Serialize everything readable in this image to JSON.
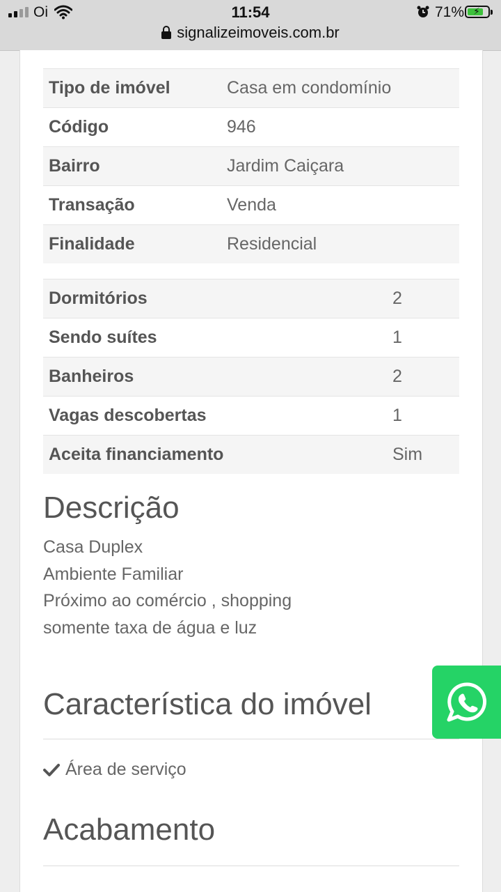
{
  "status_bar": {
    "carrier": "Oi",
    "time": "11:54",
    "battery": "71%"
  },
  "browser": {
    "url": "signalizeimoveis.com.br"
  },
  "details": [
    {
      "label": "Tipo de imóvel",
      "value": "Casa em condomínio"
    },
    {
      "label": "Código",
      "value": "946"
    },
    {
      "label": "Bairro",
      "value": "Jardim Caiçara"
    },
    {
      "label": "Transação",
      "value": "Venda"
    },
    {
      "label": "Finalidade",
      "value": "Residencial"
    }
  ],
  "rooms": [
    {
      "label": "Dormitórios",
      "value": "2"
    },
    {
      "label": "Sendo suítes",
      "value": "1"
    },
    {
      "label": "Banheiros",
      "value": "2"
    },
    {
      "label": "Vagas descobertas",
      "value": "1"
    },
    {
      "label": "Aceita financiamento",
      "value": "Sim"
    }
  ],
  "description": {
    "title": "Descrição",
    "lines": [
      "Casa Duplex",
      "Ambiente Familiar",
      "Próximo ao comércio , shopping",
      "somente taxa de água e luz"
    ]
  },
  "features": {
    "title": "Característica do imóvel",
    "items": [
      "Área de serviço"
    ]
  },
  "finishing": {
    "title": "Acabamento"
  },
  "icons": {
    "whatsapp": "whatsapp-icon",
    "check": "check-icon",
    "lock": "lock-icon"
  },
  "colors": {
    "whatsapp": "#25d366"
  }
}
